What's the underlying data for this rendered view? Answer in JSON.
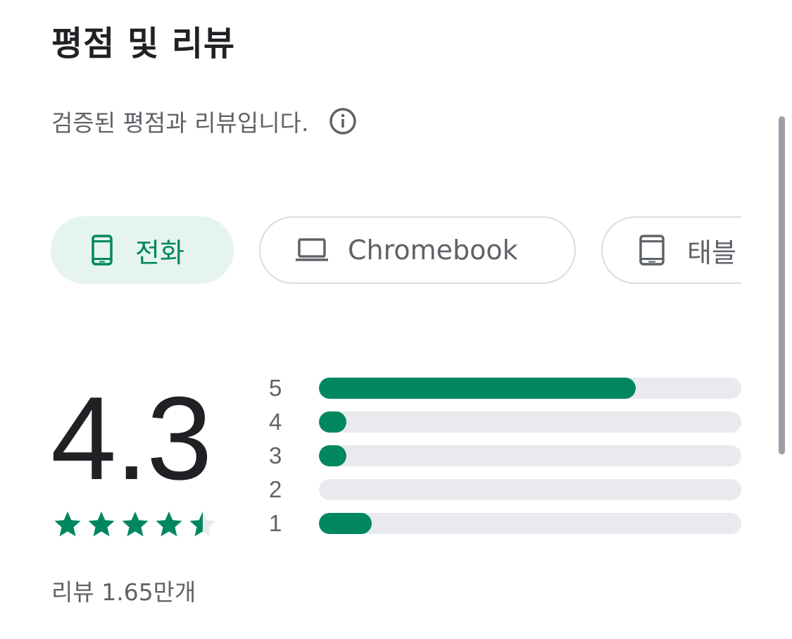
{
  "header": {
    "title": "평점 및 리뷰",
    "subtitle": "검증된 평점과 리뷰입니다."
  },
  "icons": {
    "info": "info-icon",
    "phone": "phone-icon",
    "laptop": "laptop-icon",
    "tablet": "tablet-icon",
    "star": "star-icon"
  },
  "device_chips": [
    {
      "label": "전화",
      "icon": "phone-icon",
      "selected": true
    },
    {
      "label": "Chromebook",
      "icon": "laptop-icon",
      "selected": false
    },
    {
      "label": "태블",
      "icon": "tablet-icon",
      "selected": false
    }
  ],
  "rating": {
    "score": "4.3",
    "stars": 4.5,
    "review_count": "리뷰 1.65만개"
  },
  "distribution": [
    {
      "label": "5",
      "fraction": 0.75
    },
    {
      "label": "4",
      "fraction": 0.065
    },
    {
      "label": "3",
      "fraction": 0.065
    },
    {
      "label": "2",
      "fraction": 0.0
    },
    {
      "label": "1",
      "fraction": 0.125
    }
  ],
  "colors": {
    "accent": "#01875f",
    "chip_selected_bg": "#e6f4ef",
    "track": "#e8eaed",
    "text_primary": "#202124",
    "text_secondary": "#5f6368"
  }
}
